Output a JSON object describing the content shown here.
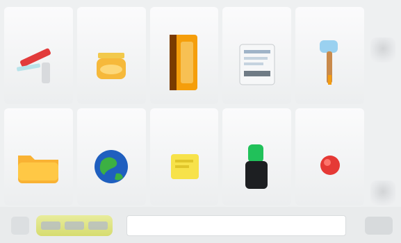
{
  "tiles": [
    {
      "label": "",
      "icon": "red-pen-icon"
    },
    {
      "label": "",
      "icon": "honey-jar-icon"
    },
    {
      "label": "",
      "icon": "orange-book-icon"
    },
    {
      "label": "",
      "icon": "document-icon"
    },
    {
      "label": "",
      "icon": "paint-brush-icon"
    },
    {
      "label": "",
      "icon": "folder-icon"
    },
    {
      "label": "",
      "icon": "globe-icon"
    },
    {
      "label": "",
      "icon": "sticky-note-icon"
    },
    {
      "label": "",
      "icon": "green-battery-icon"
    },
    {
      "label": "",
      "icon": "red-button-icon"
    }
  ],
  "search": {
    "placeholder": ""
  },
  "colors": {
    "accent": "#d6dc6f",
    "background": "#eef0f1"
  }
}
